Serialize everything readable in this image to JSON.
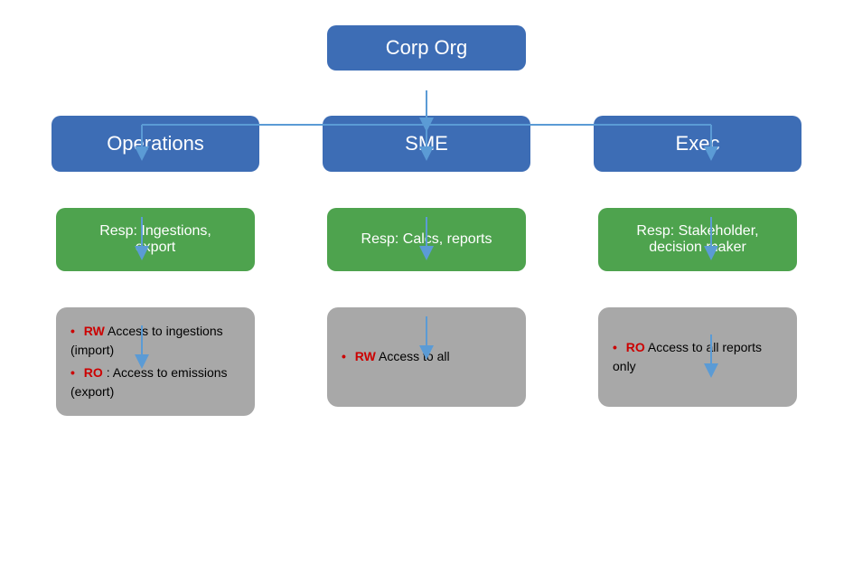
{
  "root": {
    "label": "Corp Org"
  },
  "columns": [
    {
      "id": "operations",
      "blue_label": "Operations",
      "green_label": "Resp: Ingestions,\nexport",
      "gray_items": [
        {
          "prefix": "RW",
          "text": " Access to ingestions (import)"
        },
        {
          "prefix": "RO",
          "text": ": Access to emissions (export)"
        }
      ]
    },
    {
      "id": "sme",
      "blue_label": "SME",
      "green_label": "Resp: Calcs, reports",
      "gray_items": [
        {
          "prefix": "RW",
          "text": " Access to all"
        }
      ]
    },
    {
      "id": "exec",
      "blue_label": "Exec",
      "green_label": "Resp: Stakeholder,\ndecision maker",
      "gray_items": [
        {
          "prefix": "RO",
          "text": " Access to all reports only"
        }
      ]
    }
  ]
}
